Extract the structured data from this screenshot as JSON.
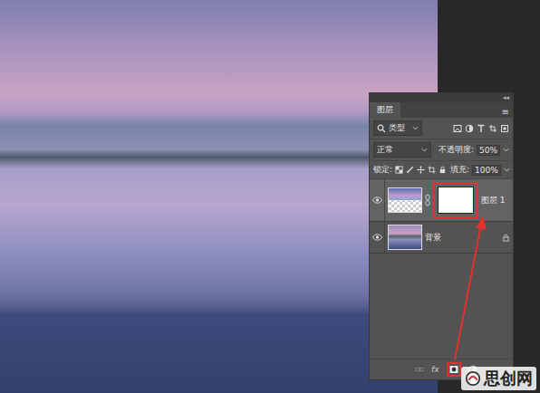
{
  "panel": {
    "title": "图层",
    "collapse": "◂◂",
    "menu": "≡"
  },
  "filter": {
    "kind": "类型"
  },
  "blend_mode": "正常",
  "opacity": {
    "label": "不透明度:",
    "value": "50%"
  },
  "lock": {
    "label": "锁定:"
  },
  "fill": {
    "label": "填充:",
    "value": "100%"
  },
  "layers": [
    {
      "name": "图层 1",
      "visible": true,
      "selected": true,
      "has_mask": true,
      "mask_highlighted": true,
      "locked": false,
      "transparent": true
    },
    {
      "name": "背景",
      "visible": true,
      "selected": false,
      "has_mask": false,
      "mask_highlighted": false,
      "locked": true,
      "transparent": false
    }
  ],
  "footer": {
    "fx": "fx",
    "mask_button_highlighted": true
  },
  "watermark": {
    "text": "思创网"
  }
}
